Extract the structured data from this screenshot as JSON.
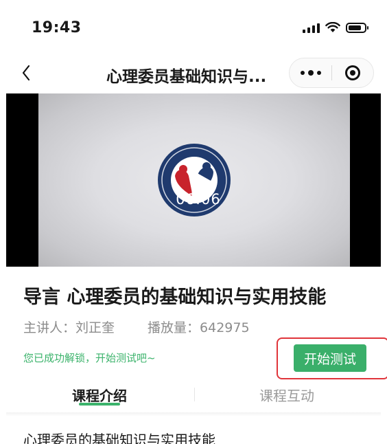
{
  "status_bar": {
    "time": "19:43",
    "icons": [
      "signal-icon",
      "wifi-icon",
      "battery-icon"
    ]
  },
  "nav": {
    "title": "心理委员基础知识与...",
    "icons": [
      "back-arrow-icon",
      "more-dots-icon",
      "close-circle-icon"
    ]
  },
  "video": {
    "duration": "06:06",
    "icons": [
      "organization-logo-icon",
      "play-icon"
    ]
  },
  "lesson": {
    "title": "导言 心理委员的基础知识与实用技能",
    "speaker_label": "主讲人：",
    "speaker": "刘正奎",
    "plays_label": "播放量：",
    "plays": "642975",
    "unlock_message": "您已成功解锁，开始测试吧~",
    "start_button": "开始测试"
  },
  "tabs": [
    {
      "label": "课程介绍",
      "active": true
    },
    {
      "label": "课程互动",
      "active": false
    }
  ],
  "intro": {
    "text": "心理委员的基础知识与实用技能"
  },
  "colors": {
    "accent_green": "#3aaf6a",
    "highlight_red": "#e0343a"
  }
}
